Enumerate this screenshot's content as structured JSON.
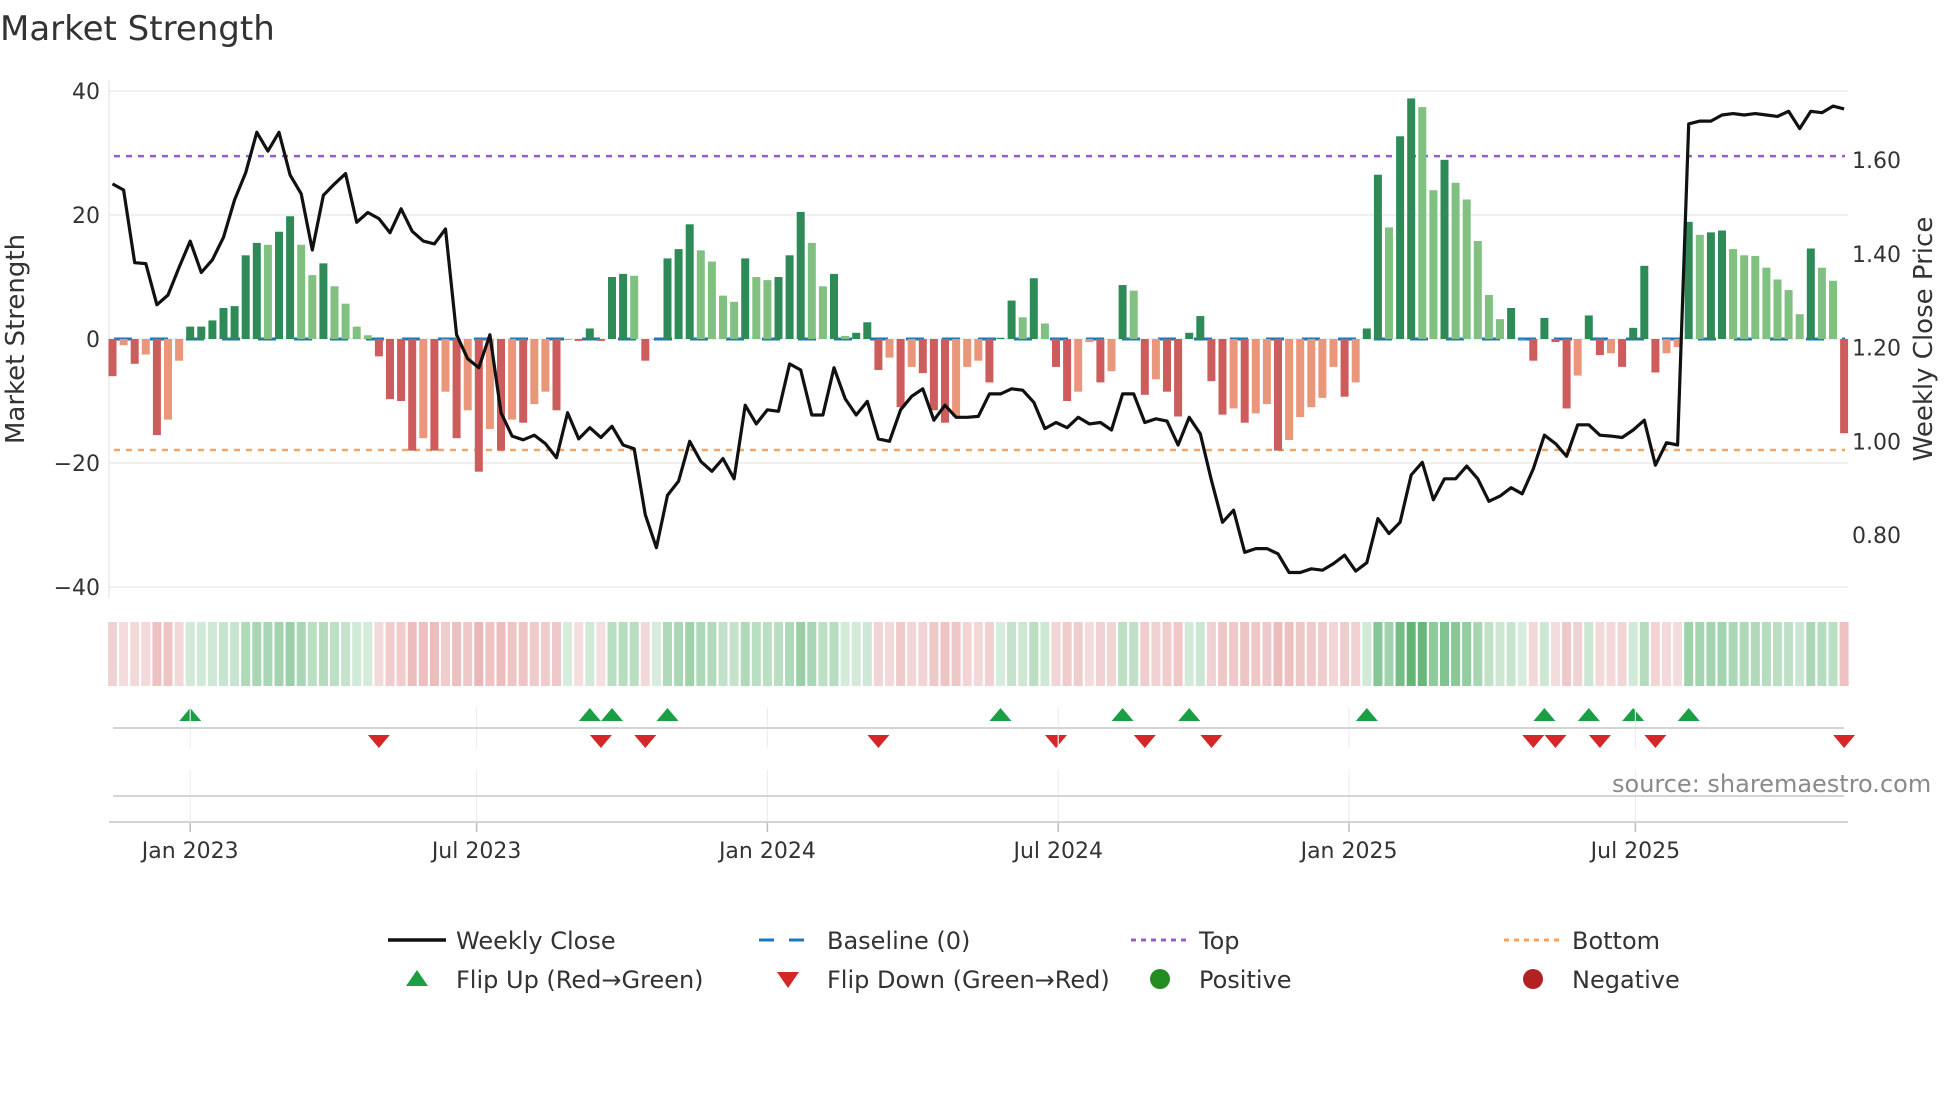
{
  "title": "Market Strength",
  "source": "source: sharemaestro.com",
  "colors": {
    "green_dark": "#2e8b57",
    "green_light": "#80c080",
    "red_dark": "#cd5c5c",
    "red_light": "#e9967a",
    "baseline": "#1f77b4",
    "top": "#9b59d6",
    "bottom": "#f4a460",
    "flip_up": "#1a9f45",
    "flip_down": "#d62728",
    "positive": "#228b22",
    "negative": "#b22222"
  },
  "legend": [
    {
      "label": "Weekly Close",
      "icon": "solid-line"
    },
    {
      "label": "Baseline (0)",
      "icon": "dashed-line"
    },
    {
      "label": "Top",
      "icon": "dotted-line"
    },
    {
      "label": "Bottom",
      "icon": "dotted-line"
    },
    {
      "label": "Flip Up (Red→Green)",
      "icon": "triangle-up"
    },
    {
      "label": "Flip Down (Green→Red)",
      "icon": "triangle-down"
    },
    {
      "label": "Positive",
      "icon": "dot"
    },
    {
      "label": "Negative",
      "icon": "dot"
    }
  ],
  "chart_data": {
    "type": "bar",
    "title": "Market Strength",
    "ylabel": "Market Strength",
    "y2label": "Weekly Close Price",
    "ylim": [
      -42,
      42
    ],
    "y2lim": [
      0.68,
      1.76
    ],
    "yticks": [
      "40",
      "20",
      "0",
      "−20",
      "−40"
    ],
    "ytick_values": [
      40,
      20,
      0,
      -20,
      -40
    ],
    "y2ticks": [
      "1.60",
      "1.40",
      "1.20",
      "1.00",
      "0.80"
    ],
    "y2tick_values": [
      1.6,
      1.4,
      1.2,
      1.0,
      0.8
    ],
    "xticks": [
      "Jan 2023",
      "Jul 2023",
      "Jan 2024",
      "Jul 2024",
      "Jan 2025",
      "Jul 2025"
    ],
    "xtick_week_index": [
      7.0,
      32.8,
      59.0,
      85.2,
      111.4,
      137.2
    ],
    "top_level": 29.5,
    "bottom_level": -17.9,
    "baseline": 0,
    "strength": [
      -6,
      -1,
      -4,
      -2.5,
      -15.5,
      -13,
      -3.5,
      2,
      2,
      3,
      5,
      5.3,
      13.5,
      15.5,
      15.2,
      17.3,
      19.8,
      15.2,
      10.3,
      12.2,
      8.5,
      5.7,
      2,
      0.6,
      -2.8,
      -9.7,
      -10,
      -18,
      -16,
      -18,
      -8.5,
      -16,
      -11.5,
      -21.4,
      -14.5,
      -18,
      -13,
      -13.5,
      -10.5,
      -8.5,
      -11.5,
      0,
      -0.3,
      1.7,
      -0.3,
      10,
      10.5,
      10.2,
      -3.5,
      0,
      13,
      14.5,
      18.5,
      14.3,
      12.5,
      7,
      6,
      13,
      10,
      9.5,
      10,
      13.5,
      20.5,
      15.5,
      8.5,
      10.5,
      0.5,
      1,
      2.7,
      -5,
      -3,
      -11,
      -4.5,
      -5.5,
      -11.5,
      -13.5,
      -12.5,
      -4.5,
      -3.5,
      -7,
      0.2,
      6.2,
      3.5,
      9.8,
      2.5,
      -4.5,
      -10,
      -8.5,
      -0.5,
      -7,
      -5.2,
      8.7,
      7.8,
      -9,
      -6.5,
      -8.5,
      -12.5,
      1,
      3.7,
      -6.8,
      -12.2,
      -11.2,
      -13.5,
      -12,
      -10.5,
      -18,
      -16.3,
      -12.6,
      -11,
      -9.5,
      -4.5,
      -9.3,
      -7,
      1.7,
      26.5,
      18,
      32.7,
      38.8,
      37.4,
      24,
      28.9,
      25.2,
      22.5,
      15.8,
      7.1,
      3.2,
      5,
      0,
      -3.5,
      3.4,
      -0.5,
      -11.2,
      -5.9,
      3.8,
      -2.6,
      -2.3,
      -4.5,
      1.8,
      11.8,
      -5.4,
      -2.3,
      -1.3,
      18.9,
      16.8,
      17.2,
      17.5,
      14.5,
      13.5,
      13.4,
      11.5,
      9.6,
      7.9,
      4,
      14.6,
      11.5,
      9.4,
      -15.2
    ],
    "weekly_close": [
      1.549,
      1.536,
      1.381,
      1.379,
      1.291,
      1.312,
      1.371,
      1.427,
      1.36,
      1.387,
      1.435,
      1.515,
      1.573,
      1.659,
      1.619,
      1.659,
      1.568,
      1.528,
      1.408,
      1.525,
      1.549,
      1.571,
      1.467,
      1.488,
      1.475,
      1.445,
      1.496,
      1.448,
      1.427,
      1.421,
      1.453,
      1.227,
      1.176,
      1.157,
      1.227,
      1.061,
      1.011,
      1.003,
      1.013,
      0.995,
      0.965,
      1.061,
      1.005,
      1.029,
      1.008,
      1.032,
      0.992,
      0.984,
      0.843,
      0.773,
      0.885,
      0.915,
      1.0,
      0.957,
      0.936,
      0.963,
      0.92,
      1.077,
      1.037,
      1.067,
      1.064,
      1.165,
      1.152,
      1.056,
      1.056,
      1.157,
      1.091,
      1.056,
      1.085,
      1.005,
      1.0,
      1.067,
      1.096,
      1.112,
      1.045,
      1.077,
      1.051,
      1.051,
      1.053,
      1.101,
      1.101,
      1.112,
      1.109,
      1.083,
      1.027,
      1.04,
      1.029,
      1.051,
      1.037,
      1.04,
      1.024,
      1.101,
      1.101,
      1.04,
      1.048,
      1.043,
      0.992,
      1.051,
      1.016,
      0.917,
      0.827,
      0.853,
      0.763,
      0.771,
      0.771,
      0.76,
      0.72,
      0.72,
      0.728,
      0.725,
      0.739,
      0.757,
      0.723,
      0.741,
      0.835,
      0.803,
      0.827,
      0.928,
      0.955,
      0.875,
      0.92,
      0.92,
      0.947,
      0.92,
      0.872,
      0.883,
      0.901,
      0.888,
      0.941,
      1.013,
      0.995,
      0.968,
      1.035,
      1.035,
      1.013,
      1.011,
      1.008,
      1.024,
      1.045,
      0.949,
      0.997,
      0.992,
      1.677,
      1.683,
      1.683,
      1.696,
      1.699,
      1.696,
      1.699,
      1.696,
      1.693,
      1.704,
      1.667,
      1.704,
      1.701,
      1.715,
      1.709
    ],
    "flip_up_index": [
      7,
      43,
      45,
      50,
      80,
      91,
      97,
      113,
      129,
      133,
      137,
      142
    ],
    "flip_down_index": [
      24,
      44,
      48,
      69,
      85,
      93,
      99,
      128,
      130,
      134,
      139,
      156
    ],
    "legend_position": "bottom-center",
    "grid": true
  }
}
